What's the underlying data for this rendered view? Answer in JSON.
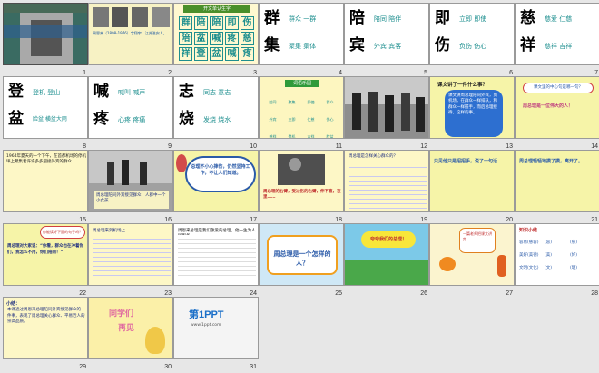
{
  "slides": [
    {
      "n": "1"
    },
    {
      "n": "2",
      "text": "周恩来（1898-1976）字翔宇，江苏淮安人。"
    },
    {
      "n": "3",
      "title": "开文单认生字",
      "grid": [
        [
          "群",
          "陪",
          "陪",
          "即",
          "伤"
        ],
        [
          "陪",
          "盆",
          "喊",
          "疼",
          "慈"
        ],
        [
          "祥",
          "登",
          "盆",
          "喊",
          "疼"
        ]
      ]
    },
    {
      "n": "4",
      "c1": "群",
      "c2": "集",
      "w1": "群众  一群",
      "w2": "聚集  集体"
    },
    {
      "n": "5",
      "c1": "陪",
      "c2": "宾",
      "w1": "陪同  陪伴",
      "w2": "外宾  宾客"
    },
    {
      "n": "6",
      "c1": "即",
      "c2": "伤",
      "w1": "立即  即使",
      "w2": "负伤  伤心"
    },
    {
      "n": "7",
      "c1": "慈",
      "c2": "祥",
      "w1": "慈爱  仁慈",
      "w2": "慈祥  吉祥"
    },
    {
      "n": "8",
      "c1": "登",
      "c2": "盆",
      "w1": "登机  登山",
      "w2": "脸盆  横盆大雨"
    },
    {
      "n": "9",
      "c1": "喊",
      "c2": "疼",
      "w1": "喊叫  喊声",
      "w2": "心疼  疼痛"
    },
    {
      "n": "10",
      "c1": "志",
      "c2": "烧",
      "w1": "同志  意志",
      "w2": "发烧  烧水"
    },
    {
      "n": "11",
      "title": "词语乐园",
      "words": [
        "陪同",
        "聚集",
        "即使",
        "群众",
        "外宾",
        "立即",
        "仁慈",
        "伤心",
        "慈祥",
        "登机",
        "吉祥",
        "脸盆",
        "喊叫",
        "发烧",
        "疼痛",
        "聚精会神",
        "同心协力",
        "团结一心"
      ]
    },
    {
      "n": "12"
    },
    {
      "n": "13",
      "q": "课文讲了一件什么事？",
      "a": "课文讲周总理陪同外宾，到机场，在群众一样排队，和群众一样握手，而后总理接待，这样的事。"
    },
    {
      "n": "14",
      "q": "课文里的中心句是哪一句？",
      "a": "周总理是一位伟大的人！"
    },
    {
      "n": "15",
      "text": "1964年夏天的一个下午，在首都机场的停机坪上聚集着许许多多迎接外宾的群众……"
    },
    {
      "n": "16",
      "cap": "周总理陪同外宾接见群众，人群中一个小女孩……"
    },
    {
      "n": "17",
      "cloud": "总理不小心摔伤，仍然坚持工作，不让人们知道。"
    },
    {
      "n": "18",
      "text": "周总理的右臂，受过伤的右臂，伸不直，夜里……"
    },
    {
      "n": "19",
      "text": "周总理是怎样关心群众的？"
    },
    {
      "n": "20",
      "text": "只见他只是招招手，说了一句话……"
    },
    {
      "n": "21",
      "text": "周总理轻轻地摸了摸，离开了。"
    },
    {
      "n": "22",
      "bubble": "你能读好下面的句子吗？",
      "text": "周总理对大家说：“你看，群众也在冲着你们，我怎么不用，你们陪同！”"
    },
    {
      "n": "23",
      "text": "周总理来到机场上……"
    },
    {
      "n": "24",
      "text": "周恩来总理是我们敬爱的总理，他一生为人民服务……"
    },
    {
      "n": "25",
      "banner": "周总理是一个怎样的人？"
    },
    {
      "n": "26",
      "bubble": "夸夸我们的总理！"
    },
    {
      "n": "27",
      "text": "一篇老师把课文讲完……"
    },
    {
      "n": "28",
      "title": "知识小结",
      "rows": [
        [
          "容易(慈容)",
          "(容)",
          "(慈)"
        ],
        [
          "美好(美德)",
          "(美)",
          "(好)"
        ],
        [
          "文明(文化)",
          "(文)",
          "(明)"
        ]
      ]
    },
    {
      "n": "29",
      "title": "小结：",
      "text": "本课通过周恩来总理陪同外宾接见群众的一件事，表现了周总理关心群众、平易近人的崇高品质。"
    },
    {
      "n": "30",
      "line1": "同学们",
      "line2": "再见"
    },
    {
      "n": "31",
      "line1": "第1PPT",
      "line2": "www.1ppt.com"
    }
  ],
  "colors": {
    "teal": "#1e8f8f",
    "navy": "#203080",
    "yellow": "#f6f4a8",
    "cream": "#fbf4cf",
    "blue": "#2a5aa8",
    "sel": "#b9c8e8"
  }
}
